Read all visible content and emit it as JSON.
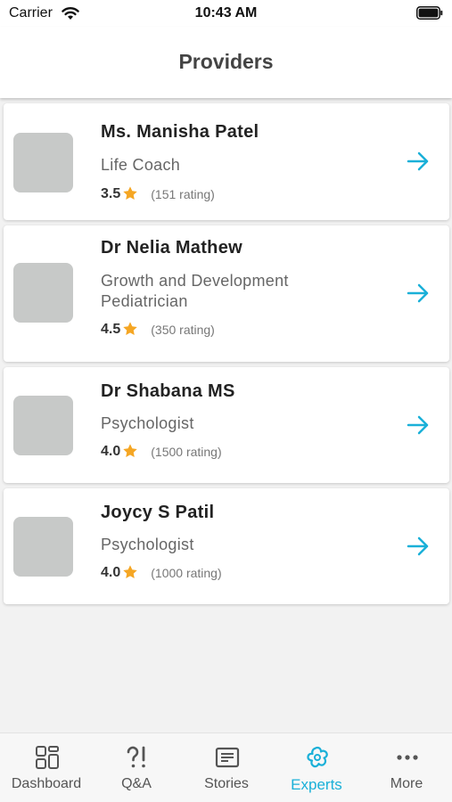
{
  "status_bar": {
    "carrier": "Carrier",
    "time": "10:43 AM"
  },
  "header": {
    "title": "Providers"
  },
  "colors": {
    "accent": "#1ab0d8",
    "star": "#f5a623",
    "avatar_placeholder": "#c7c9c8"
  },
  "providers": [
    {
      "name": "Ms. Manisha Patel",
      "specialty": "Life Coach",
      "rating": "3.5",
      "rating_count": "(151 rating)"
    },
    {
      "name": "Dr Nelia Mathew",
      "specialty": "Growth and Development Pediatrician",
      "rating": "4.5",
      "rating_count": "(350 rating)"
    },
    {
      "name": "Dr Shabana MS",
      "specialty": "Psychologist",
      "rating": "4.0",
      "rating_count": "(1500 rating)"
    },
    {
      "name": "Joycy S Patil",
      "specialty": "Psychologist",
      "rating": "4.0",
      "rating_count": "(1000 rating)"
    }
  ],
  "tabbar": {
    "active": "Experts",
    "tabs": [
      {
        "label": "Dashboard",
        "icon": "dashboard-grid-icon"
      },
      {
        "label": "Q&A",
        "icon": "question-exclamation-icon"
      },
      {
        "label": "Stories",
        "icon": "stories-icon"
      },
      {
        "label": "Experts",
        "icon": "experts-flower-icon"
      },
      {
        "label": "More",
        "icon": "more-dots-icon"
      }
    ]
  }
}
